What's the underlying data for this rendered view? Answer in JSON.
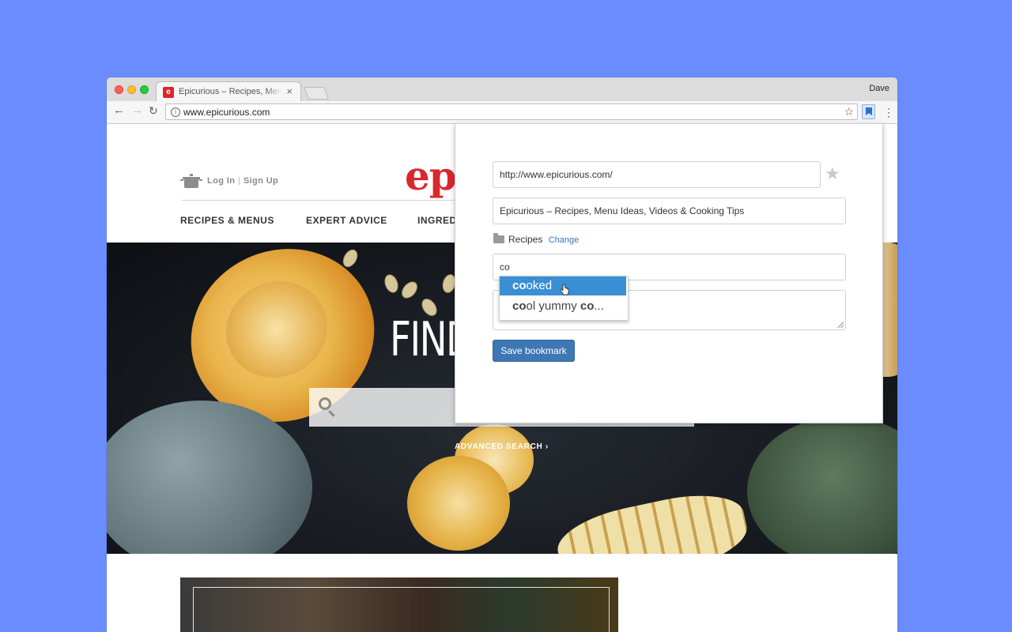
{
  "browser": {
    "tab_title": "Epicurious – Recipes, Menu Ideas, Videos & Cooking Tips",
    "tab_favicon": "e",
    "tab_close": "×",
    "profile": "Dave",
    "url": "www.epicurious.com",
    "icons": [
      "back-arrow-icon",
      "forward-arrow-icon",
      "reload-icon",
      "info-icon",
      "star-icon",
      "bookmark-extension-icon",
      "more-menu-icon"
    ]
  },
  "site": {
    "login": "Log In",
    "signup": "Sign Up",
    "logo": "epicurious",
    "nav": [
      "RECIPES & MENUS",
      "EXPERT ADVICE",
      "INGREDIENTS"
    ],
    "hero_title": "FIND",
    "advanced_search": "ADVANCED SEARCH"
  },
  "popup": {
    "url_value": "http://www.epicurious.com/",
    "title_value": "Epicurious – Recipes, Menu Ideas, Videos & Cooking Tips",
    "folder_label": "Recipes",
    "change_link": "Change",
    "tags_value": "co",
    "notes_value": "",
    "save_label": "Save bookmark",
    "suggestions": [
      {
        "match": "co",
        "rest": "oked"
      },
      {
        "match": "co",
        "rest": "ol yummy ",
        "match2": "co",
        "rest2": "..."
      }
    ]
  },
  "colors": {
    "background": "#6b8cff",
    "brand_red": "#d9272e",
    "save_button": "#3d78b5",
    "suggestion_highlight": "#3a8fd4",
    "link": "#3a73c3"
  }
}
